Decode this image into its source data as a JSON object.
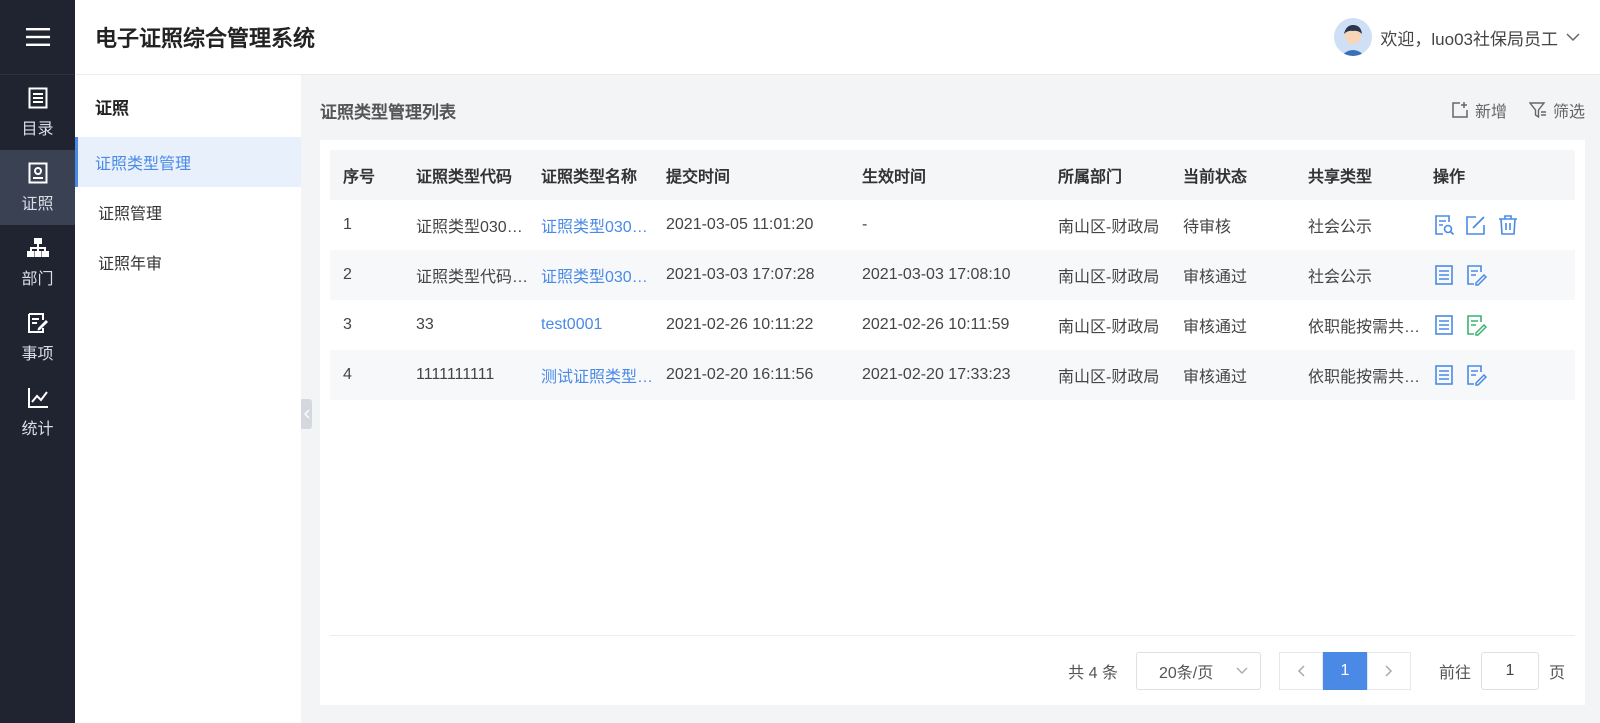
{
  "header": {
    "title": "电子证照综合管理系统",
    "greeting": "欢迎，luo03社保局员工"
  },
  "rail": {
    "items": [
      {
        "label": "目录",
        "icon": "list-icon"
      },
      {
        "label": "证照",
        "icon": "license-icon",
        "active": true
      },
      {
        "label": "部门",
        "icon": "org-icon"
      },
      {
        "label": "事项",
        "icon": "edit-doc-icon"
      },
      {
        "label": "统计",
        "icon": "chart-icon"
      }
    ]
  },
  "subnav": {
    "title": "证照",
    "items": [
      {
        "label": "证照类型管理",
        "active": true
      },
      {
        "label": "证照管理"
      },
      {
        "label": "证照年审"
      }
    ]
  },
  "main": {
    "title": "证照类型管理列表",
    "add_label": "新增",
    "filter_label": "筛选"
  },
  "table": {
    "headers": [
      "序号",
      "证照类型代码",
      "证照类型名称",
      "提交时间",
      "生效时间",
      "所属部门",
      "当前状态",
      "共享类型",
      "操作"
    ],
    "rows": [
      [
        "1",
        "证照类型030…",
        "证照类型030…",
        "2021-03-05 11:01:20",
        "-",
        "南山区-财政局",
        "待审核",
        "社会公示"
      ],
      [
        "2",
        "证照类型代码…",
        "证照类型030…",
        "2021-03-03 17:07:28",
        "2021-03-03 17:08:10",
        "南山区-财政局",
        "审核通过",
        "社会公示"
      ],
      [
        "3",
        "33",
        "test0001",
        "2021-02-26 10:11:22",
        "2021-02-26 10:11:59",
        "南山区-财政局",
        "审核通过",
        "依职能按需共…"
      ],
      [
        "4",
        "1111111111",
        "测试证照类型…",
        "2021-02-20 16:11:56",
        "2021-02-20 17:33:23",
        "南山区-财政局",
        "审核通过",
        "依职能按需共…"
      ]
    ]
  },
  "pager": {
    "total": "共 4 条",
    "page_size": "20条/页",
    "current_page": "1",
    "goto_label": "前往",
    "goto_value": "1",
    "page_suffix": "页"
  },
  "colors": {
    "accent": "#4a8ae6",
    "rail_bg": "#1f2430",
    "green_icon": "#3cb371"
  }
}
